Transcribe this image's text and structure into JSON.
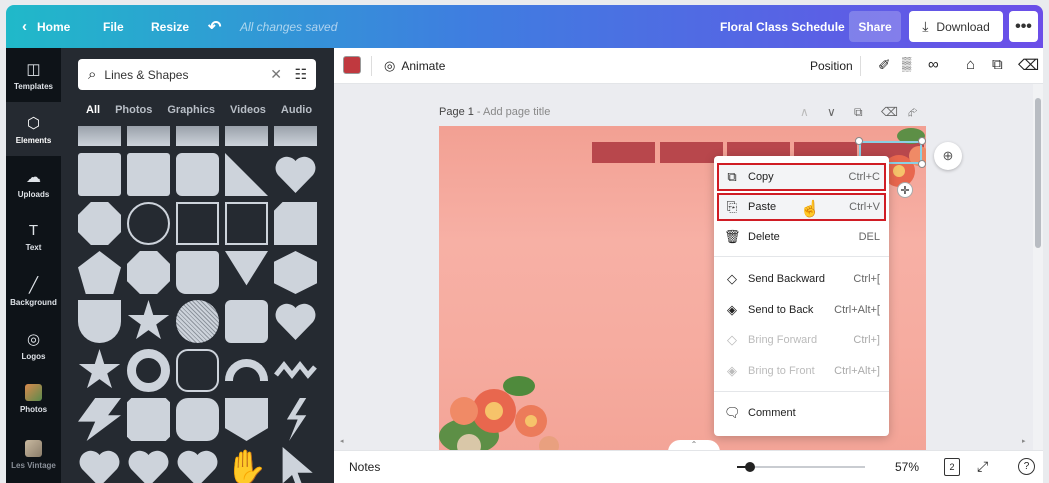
{
  "topbar": {
    "home": "Home",
    "file": "File",
    "resize": "Resize",
    "saved": "All changes saved",
    "title": "Floral Class Schedule",
    "share": "Share",
    "download": "Download",
    "more": "•••"
  },
  "rail": {
    "items": [
      {
        "label": "Templates",
        "icon": "◫"
      },
      {
        "label": "Elements",
        "icon": "⬡"
      },
      {
        "label": "Uploads",
        "icon": "☁"
      },
      {
        "label": "Text",
        "icon": "T"
      },
      {
        "label": "Background",
        "icon": "╱"
      },
      {
        "label": "Logos",
        "icon": "◎"
      },
      {
        "label": "Photos",
        "icon": ""
      },
      {
        "label": "Les Vintage",
        "icon": ""
      }
    ]
  },
  "panel": {
    "search_value": "Lines & Shapes",
    "tabs": [
      "All",
      "Photos",
      "Graphics",
      "Videos",
      "Audio"
    ]
  },
  "ctx": {
    "color": "#c0393f",
    "animate": "Animate",
    "position": "Position"
  },
  "page": {
    "label": "Page 1",
    "sub": " - Add page title"
  },
  "menu": {
    "items": [
      {
        "label": "Copy",
        "shortcut": "Ctrl+C",
        "icon": "⧉"
      },
      {
        "label": "Paste",
        "shortcut": "Ctrl+V",
        "icon": "⎘"
      },
      {
        "label": "Delete",
        "shortcut": "DEL",
        "icon": "🗑"
      },
      {
        "label": "Send Backward",
        "shortcut": "Ctrl+[",
        "icon": "◇"
      },
      {
        "label": "Send to Back",
        "shortcut": "Ctrl+Alt+[",
        "icon": "◈"
      },
      {
        "label": "Bring Forward",
        "shortcut": "Ctrl+]",
        "icon": "◇"
      },
      {
        "label": "Bring to Front",
        "shortcut": "Ctrl+Alt+]",
        "icon": "◈"
      },
      {
        "label": "Comment",
        "shortcut": "",
        "icon": "🗨"
      }
    ]
  },
  "bottom": {
    "notes": "Notes",
    "zoom": "57%",
    "zoom_fraction": 0.1,
    "pages": "2",
    "help": "?"
  }
}
